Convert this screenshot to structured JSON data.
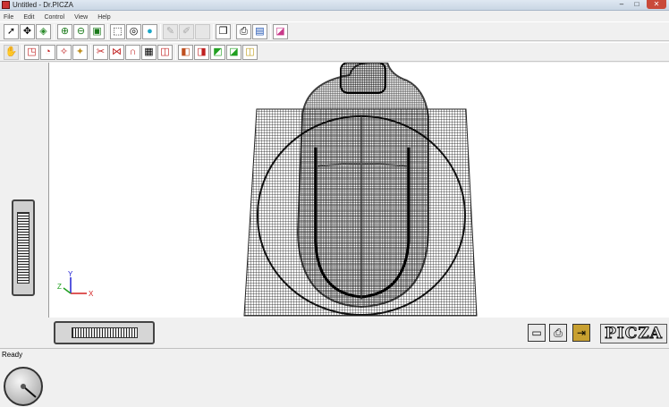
{
  "window": {
    "title": "Untitled - Dr.PICZA",
    "minimize": "–",
    "maximize": "□",
    "close": "✕"
  },
  "menu": [
    "File",
    "Edit",
    "Control",
    "View",
    "Help"
  ],
  "toolbar1": [
    {
      "name": "select-arrow-icon",
      "glyph": "➚"
    },
    {
      "name": "move-cross-icon",
      "glyph": "✥"
    },
    {
      "name": "rotate-object-icon",
      "glyph": "◈"
    },
    {
      "name": "zoom-in-icon",
      "glyph": "⊕"
    },
    {
      "name": "zoom-out-icon",
      "glyph": "⊖"
    },
    {
      "name": "zoom-fit-icon",
      "glyph": "▣"
    },
    {
      "name": "wireframe-box-icon",
      "glyph": "⬚"
    },
    {
      "name": "shaded-box-icon",
      "glyph": "◎"
    },
    {
      "name": "sphere-icon",
      "glyph": "●"
    },
    {
      "name": "paint-icon",
      "glyph": "✎"
    },
    {
      "name": "brush-icon",
      "glyph": "✐"
    },
    {
      "name": "blank-icon",
      "glyph": ""
    },
    {
      "name": "cube-view-icon",
      "glyph": "❒"
    },
    {
      "name": "print-preview-icon",
      "glyph": "⎙"
    },
    {
      "name": "chart-icon",
      "glyph": "▤"
    },
    {
      "name": "eraser-icon",
      "glyph": "◪"
    }
  ],
  "toolbar2": [
    {
      "name": "hand-icon",
      "glyph": "✋"
    },
    {
      "name": "select-region-icon",
      "glyph": "◳"
    },
    {
      "name": "select-lasso-icon",
      "glyph": "◔"
    },
    {
      "name": "select-magic-icon",
      "glyph": "✧"
    },
    {
      "name": "select-all-icon",
      "glyph": "✦"
    },
    {
      "name": "cut-icon",
      "glyph": "✂"
    },
    {
      "name": "mirror-icon",
      "glyph": "⋈"
    },
    {
      "name": "arch-icon",
      "glyph": "∩"
    },
    {
      "name": "grid-icon",
      "glyph": "▦"
    },
    {
      "name": "frame-icon",
      "glyph": "◫"
    },
    {
      "name": "cube-front-icon",
      "glyph": "◧"
    },
    {
      "name": "cube-red-icon",
      "glyph": "◨"
    },
    {
      "name": "cube-green-icon",
      "glyph": "◩"
    },
    {
      "name": "cube-green2-icon",
      "glyph": "◪"
    },
    {
      "name": "cube-yellow-icon",
      "glyph": "◫"
    }
  ],
  "axes": {
    "x": "X",
    "y": "Y",
    "z": "Z",
    "x_color": "#d42020",
    "y_color": "#2020d4",
    "z_color": "#20a020"
  },
  "bottom": {
    "logo": "PICZA",
    "print_glyph": "⎙",
    "scan_glyph": "▭",
    "exit_glyph": "⇥"
  },
  "status": "Ready"
}
